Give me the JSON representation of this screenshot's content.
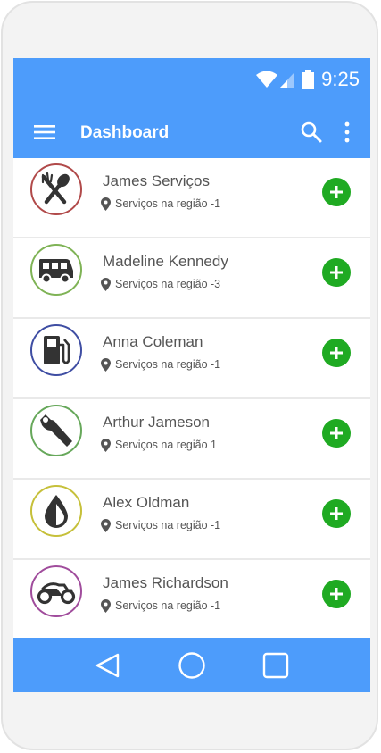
{
  "status_bar": {
    "time": "9:25"
  },
  "app_bar": {
    "title": "Dashboard"
  },
  "colors": {
    "primary": "#4d9cfb",
    "add_button": "#1faa22",
    "text": "#555555"
  },
  "list": [
    {
      "name": "James Serviços",
      "location": "Serviços na região -1",
      "icon": "restaurant-icon",
      "ring_color": "#b14a4a"
    },
    {
      "name": "Madeline Kennedy",
      "location": "Serviços na região -3",
      "icon": "bus-icon",
      "ring_color": "#7fb356"
    },
    {
      "name": "Anna Coleman",
      "location": "Serviços na região -1",
      "icon": "gas-station-icon",
      "ring_color": "#3f4ea3"
    },
    {
      "name": "Arthur Jameson",
      "location": "Serviços na região 1",
      "icon": "wrench-icon",
      "ring_color": "#67a85b"
    },
    {
      "name": "Alex Oldman",
      "location": "Serviços na região -1",
      "icon": "water-drop-icon",
      "ring_color": "#c6c03a"
    },
    {
      "name": "James Richardson",
      "location": "Serviços na região -1",
      "icon": "motorcycle-icon",
      "ring_color": "#a04c9c"
    }
  ],
  "nav": {
    "back": "back-icon",
    "home": "home-icon",
    "recents": "recents-icon"
  }
}
